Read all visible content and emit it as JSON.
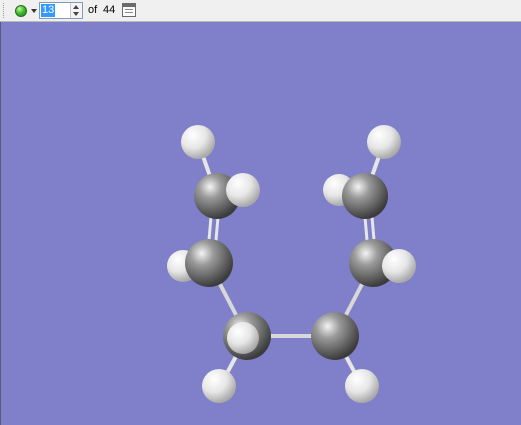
{
  "toolbar": {
    "status_icon": "green-ball-icon",
    "current_frame": "13",
    "of_label": "of",
    "total_frames": "44",
    "options_icon": "calendar-grid-icon"
  },
  "viewer": {
    "background_color": "#7f7fca",
    "carbon_color": "#7a7a7a",
    "hydrogen_color": "#e8e8e8",
    "bond_color": "#ececec"
  }
}
